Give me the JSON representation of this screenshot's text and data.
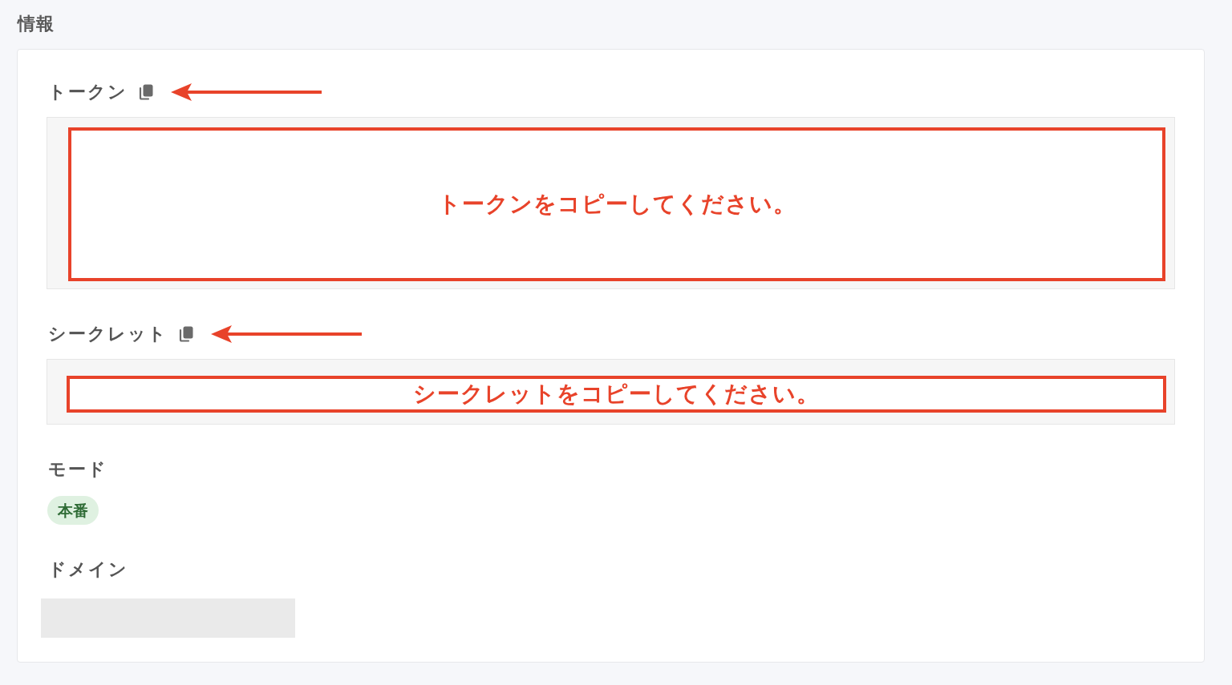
{
  "section_title": "情報",
  "fields": [
    {
      "kind": "multiline_value",
      "label": "トークン",
      "copy_icon": true,
      "arrow": true,
      "callout": "トークンをコピーしてください。"
    },
    {
      "kind": "single_line_value",
      "label": "シークレット",
      "copy_icon": true,
      "arrow": true,
      "callout": "シークレットをコピーしてください。"
    },
    {
      "kind": "tag",
      "label": "モード",
      "value": "本番"
    },
    {
      "kind": "redacted",
      "label": "ドメイン"
    }
  ]
}
